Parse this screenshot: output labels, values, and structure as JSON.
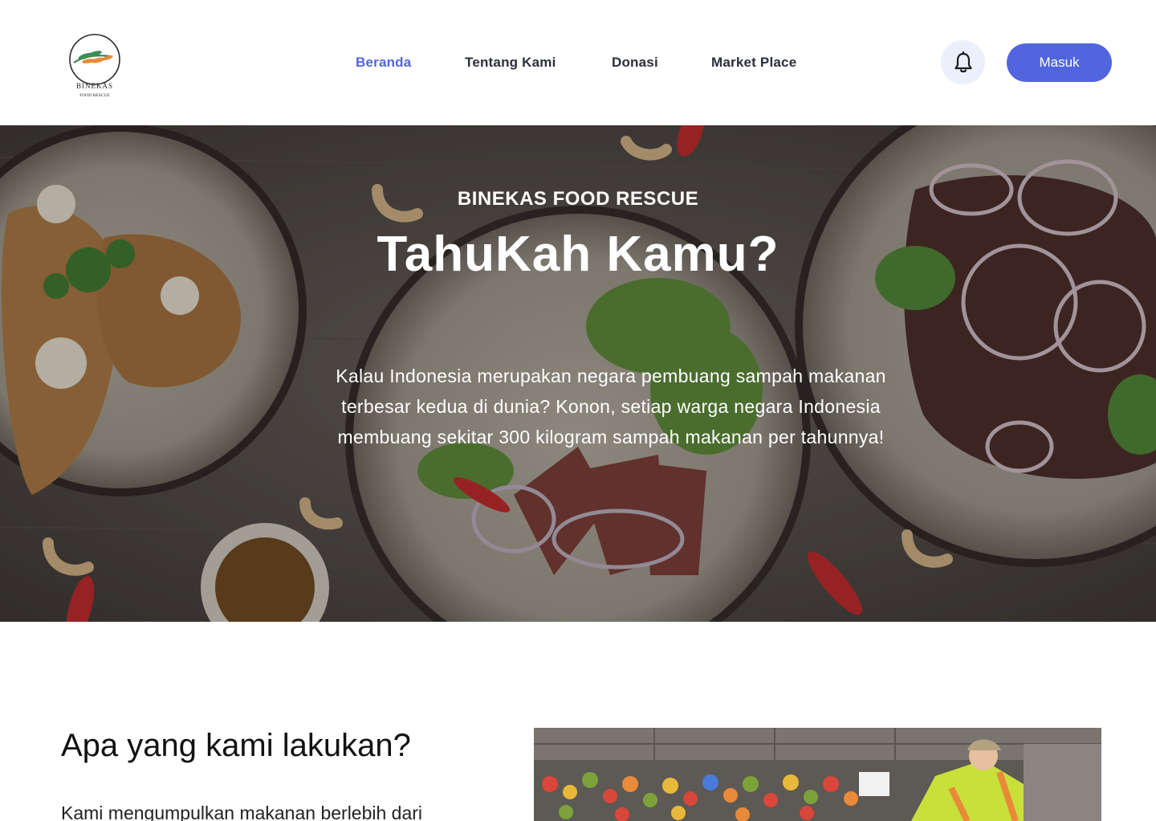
{
  "nav": {
    "logo": {
      "brand": "BINEKAS",
      "sub": "FOOD RESCUE"
    },
    "links": [
      {
        "label": "Beranda",
        "active": true
      },
      {
        "label": "Tentang Kami",
        "active": false
      },
      {
        "label": "Donasi",
        "active": false
      },
      {
        "label": "Market Place",
        "active": false
      }
    ],
    "bell_icon": "bell-icon",
    "login_label": "Masuk"
  },
  "hero": {
    "eyebrow": "BINEKAS FOOD RESCUE",
    "title": "TahuKah Kamu?",
    "body": "Kalau Indonesia merupakan negara pembuang sampah makanan terbesar kedua di dunia? Konon, setiap warga negara Indonesia membuang sekitar 300 kilogram sampah makanan per tahunnya!"
  },
  "about": {
    "title": "Apa yang kami lakukan?",
    "body": "Kami mengumpulkan makanan berlebih dari"
  },
  "colors": {
    "accent": "#5165df",
    "bell_bg": "#eceffc"
  }
}
